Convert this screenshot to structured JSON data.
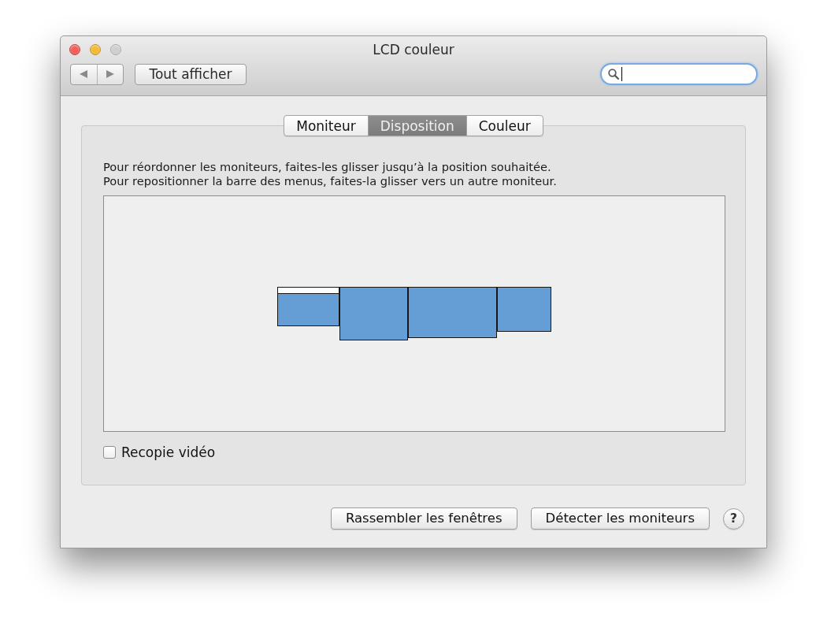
{
  "window": {
    "title": "LCD couleur",
    "window_buttons": [
      {
        "kind": "close",
        "disabled": false
      },
      {
        "kind": "minimize",
        "disabled": false
      },
      {
        "kind": "zoom",
        "disabled": true
      }
    ]
  },
  "toolbar": {
    "show_all_button": "Tout afficher",
    "search": {
      "focused": true
    }
  },
  "tabs": [
    {
      "label": "Moniteur",
      "selected": false
    },
    {
      "label": "Disposition",
      "selected": true
    },
    {
      "label": "Couleur",
      "selected": false
    }
  ],
  "instructions": [
    "Pour réordonner les moniteurs, faites-les glisser jusqu’à la position souhaitée.",
    "Pour repositionner la barre des menus, faites-la glisser vers un autre moniteur."
  ],
  "monitors": [
    {
      "menu_bar": true
    },
    {
      "menu_bar": false
    },
    {
      "menu_bar": false
    },
    {
      "menu_bar": false
    }
  ],
  "video_mirroring": {
    "label": "Recopie vidéo",
    "checked": false
  },
  "buttons": [
    "Rassembler les fenêtres",
    "Détecter les moniteurs"
  ],
  "help_button": "?"
}
